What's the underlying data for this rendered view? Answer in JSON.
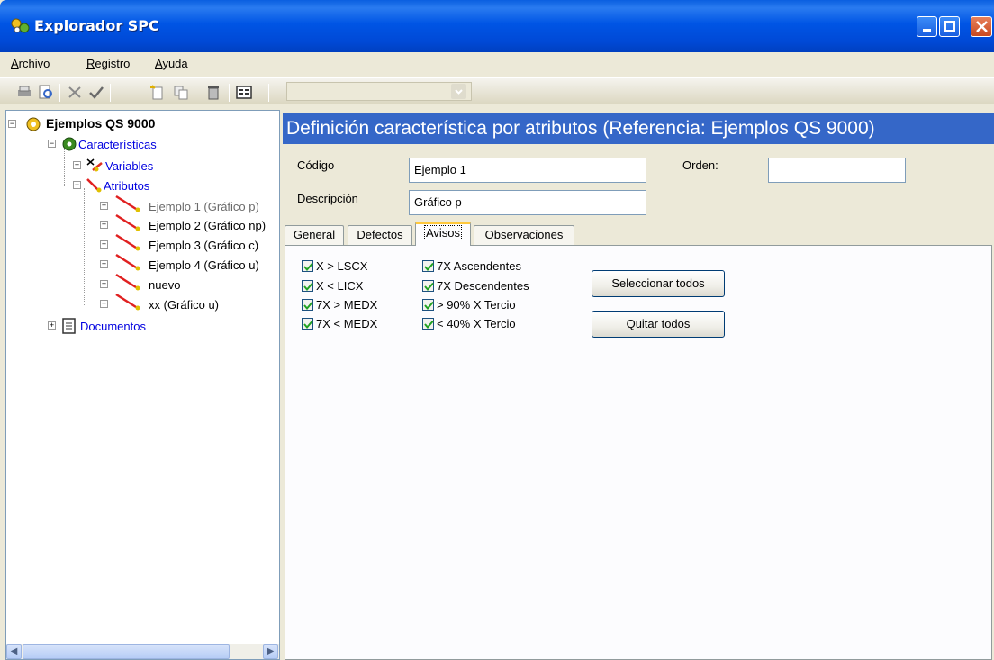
{
  "window": {
    "title": "Explorador SPC"
  },
  "menu": {
    "items": [
      "Archivo",
      "Registro",
      "Ayuda"
    ]
  },
  "toolbar": {
    "icons": [
      "print-icon",
      "print-preview-icon",
      "delete-icon",
      "accept-icon",
      "new-icon",
      "copy-icon",
      "trash-icon",
      "properties-icon"
    ],
    "combo_value": ""
  },
  "tree": {
    "root": "Ejemplos QS 9000",
    "caracteristicas": "Características",
    "variables": "Variables",
    "atributos": "Atributos",
    "items": [
      "Ejemplo 1 (Gráfico p)",
      "Ejemplo 2 (Gráfico np)",
      "Ejemplo 3 (Gráfico c)",
      "Ejemplo 4 (Gráfico u)",
      "nuevo",
      "xx (Gráfico u)"
    ],
    "documentos": "Documentos"
  },
  "header": {
    "title": "Definición característica por atributos (Referencia: Ejemplos QS 9000)"
  },
  "form": {
    "codigo_label": "Código",
    "codigo_value": "Ejemplo 1",
    "descripcion_label": "Descripción",
    "descripcion_value": "Gráfico p",
    "orden_label": "Orden:",
    "orden_value": ""
  },
  "tabs": [
    "General",
    "Defectos",
    "Avisos",
    "Observaciones"
  ],
  "active_tab": "Avisos",
  "avisos": {
    "col1": [
      {
        "label": "X > LSCX",
        "checked": true
      },
      {
        "label": "X < LICX",
        "checked": true
      },
      {
        "label": "7X > MEDX",
        "checked": true
      },
      {
        "label": "7X < MEDX",
        "checked": true
      }
    ],
    "col2": [
      {
        "label": "7X Ascendentes",
        "checked": true
      },
      {
        "label": "7X Descendentes",
        "checked": true
      },
      {
        "label": "> 90% X Tercio",
        "checked": true
      },
      {
        "label": "< 40% X Tercio",
        "checked": true
      }
    ],
    "select_all_label": "Seleccionar todos",
    "clear_all_label": "Quitar todos"
  }
}
